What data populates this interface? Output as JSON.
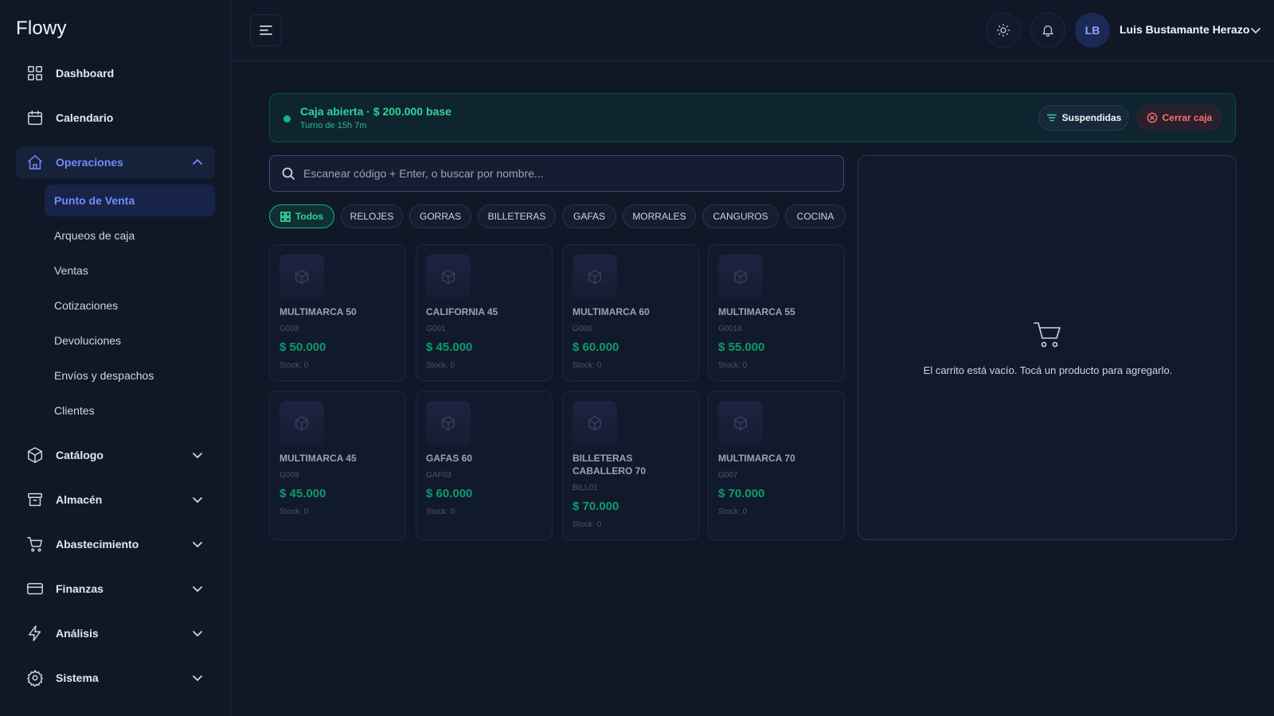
{
  "app": {
    "brand": "Flowy"
  },
  "sidebar": {
    "items": [
      {
        "label": "Dashboard",
        "icon": "dashboard-icon"
      },
      {
        "label": "Calendario",
        "icon": "calendar-icon"
      },
      {
        "label": "Operaciones",
        "icon": "home-icon",
        "expanded": true
      },
      {
        "label": "Catálogo",
        "icon": "box-icon"
      },
      {
        "label": "Almacén",
        "icon": "archive-icon"
      },
      {
        "label": "Abastecimiento",
        "icon": "cart-icon"
      },
      {
        "label": "Finanzas",
        "icon": "credit-card-icon"
      },
      {
        "label": "Análisis",
        "icon": "bolt-icon"
      },
      {
        "label": "Sistema",
        "icon": "gear-icon"
      }
    ],
    "sub_items": [
      {
        "label": "Punto de Venta",
        "active": true
      },
      {
        "label": "Arqueos de caja"
      },
      {
        "label": "Ventas"
      },
      {
        "label": "Cotizaciones"
      },
      {
        "label": "Devoluciones"
      },
      {
        "label": "Envíos y despachos"
      },
      {
        "label": "Clientes"
      }
    ]
  },
  "header": {
    "user_initials": "LB",
    "user_name": "Luis Bustamante Herazo"
  },
  "caja": {
    "title": "Caja abierta · $ 200.000 base",
    "subtitle": "Turno de 15h 7m",
    "suspended_label": "Suspendidas",
    "close_label": "Cerrar caja"
  },
  "search": {
    "placeholder": "Escanear código + Enter, o buscar por nombre...",
    "value": ""
  },
  "categories": [
    {
      "label": "Todos",
      "active": true
    },
    {
      "label": "RELOJES"
    },
    {
      "label": "GORRAS"
    },
    {
      "label": "BILLETERAS"
    },
    {
      "label": "GAFAS"
    },
    {
      "label": "MORRALES"
    },
    {
      "label": "CANGUROS"
    },
    {
      "label": "COCINA"
    }
  ],
  "products": [
    {
      "name": "MULTIMARCA 50",
      "code": "G003",
      "price": "$ 50.000",
      "stock": "Stock: 0"
    },
    {
      "name": "CALIFORNIA 45",
      "code": "G001",
      "price": "$ 45.000",
      "stock": "Stock: 0"
    },
    {
      "name": "MULTIMARCA 60",
      "code": "G006",
      "price": "$ 60.000",
      "stock": "Stock: 0"
    },
    {
      "name": "MULTIMARCA 55",
      "code": "G0016",
      "price": "$ 55.000",
      "stock": "Stock: 0"
    },
    {
      "name": "MULTIMARCA 45",
      "code": "G009",
      "price": "$ 45.000",
      "stock": "Stock: 0"
    },
    {
      "name": "GAFAS 60",
      "code": "GAF03",
      "price": "$ 60.000",
      "stock": "Stock: 0"
    },
    {
      "name": "BILLETERAS CABALLERO 70",
      "code": "BILL01",
      "price": "$ 70.000",
      "stock": "Stock: 0"
    },
    {
      "name": "MULTIMARCA 70",
      "code": "G007",
      "price": "$ 70.000",
      "stock": "Stock: 0"
    }
  ],
  "cart": {
    "empty_message": "El carrito está vacío. Tocá un producto para agregarlo."
  },
  "colors": {
    "accent": "#6f8bff",
    "success": "#34d399",
    "danger": "#f87171",
    "background": "#101828"
  }
}
